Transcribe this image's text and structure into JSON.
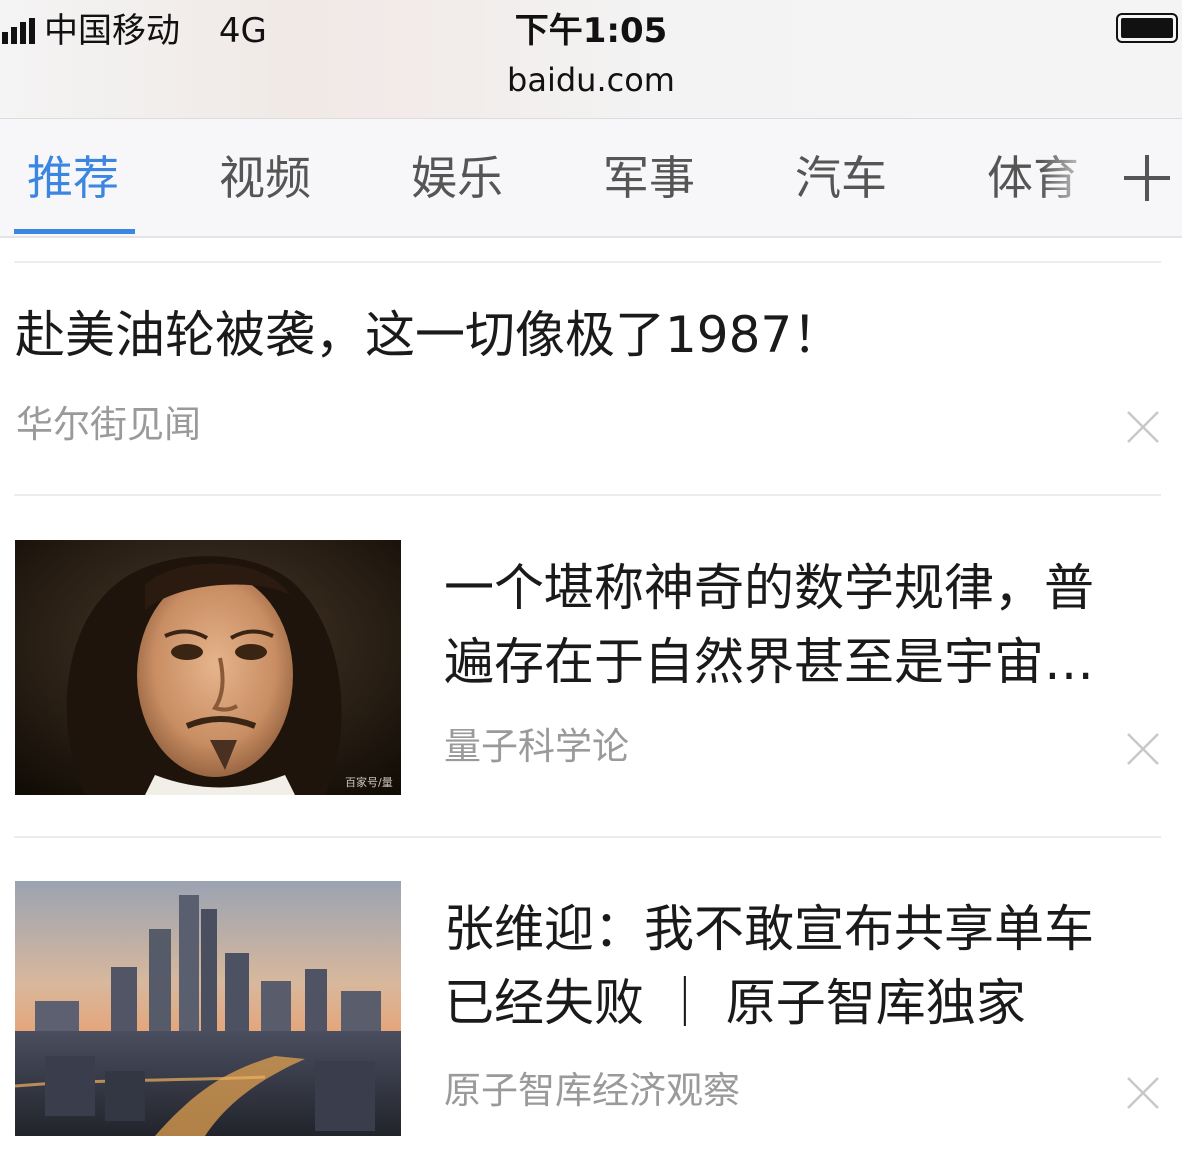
{
  "status_bar": {
    "carrier": "中国移动",
    "network": "4G",
    "time": "下午1:05",
    "url": "baidu.com"
  },
  "tabs": [
    {
      "label": "推荐",
      "active": true
    },
    {
      "label": "视频",
      "active": false
    },
    {
      "label": "娱乐",
      "active": false
    },
    {
      "label": "军事",
      "active": false
    },
    {
      "label": "汽车",
      "active": false
    },
    {
      "label": "体育",
      "active": false
    }
  ],
  "colors": {
    "accent": "#3a86e0",
    "title_text": "#1a1a1a",
    "source_text": "#9a9a9a"
  },
  "feed": [
    {
      "title": "赴美油轮被袭，这一切像极了1987！",
      "source": "华尔街见闻"
    },
    {
      "title_lines": [
        "一个堪称神奇的数学规律，普",
        "遍存在于自然界甚至是宇宙…"
      ],
      "source": "量子科学论",
      "thumbnail": "portrait-image",
      "thumbnail_watermark": "百家号/量"
    },
    {
      "title_lines": [
        "张维迎：我不敢宣布共享单车",
        "已经失败 ｜ 原子智库独家"
      ],
      "source": "原子智库经济观察",
      "thumbnail": "city-skyline-image"
    }
  ],
  "icons": {
    "signal": "signal-bars-icon",
    "battery": "battery-icon",
    "add_channel": "plus-icon",
    "dismiss": "close-icon"
  }
}
